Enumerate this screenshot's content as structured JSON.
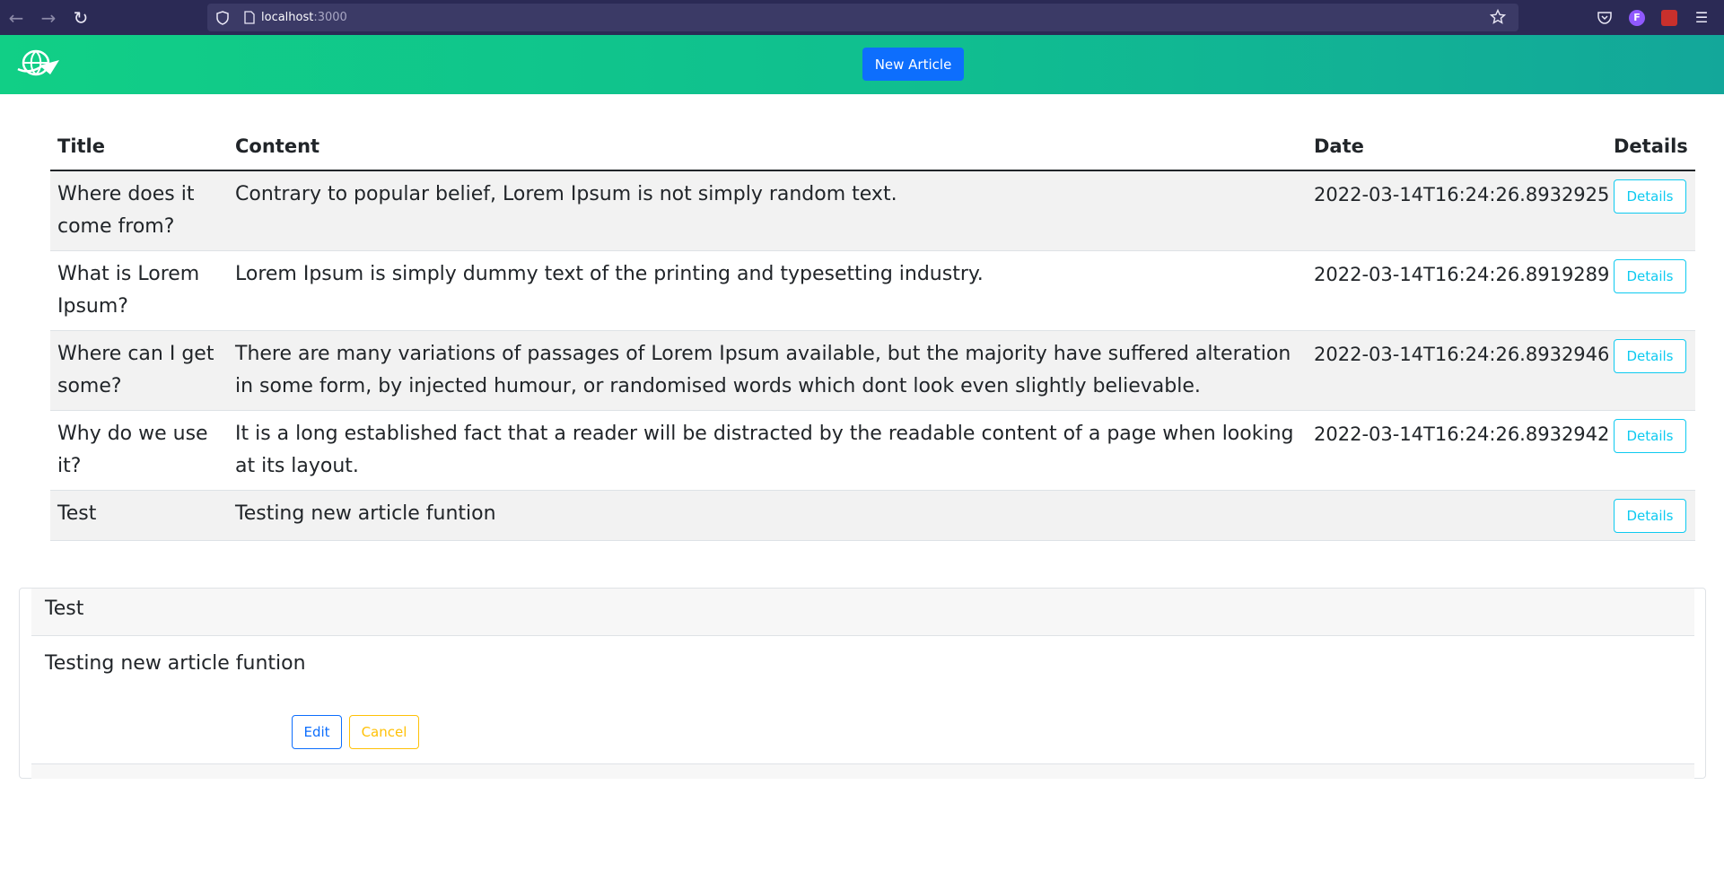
{
  "browser": {
    "url_host": "localhost",
    "url_port": ":3000",
    "profile_initial": "F"
  },
  "header": {
    "new_article_label": "New Article"
  },
  "table": {
    "columns": [
      "Title",
      "Content",
      "Date",
      "Details"
    ],
    "rows": [
      {
        "title": "Where does it come from?",
        "content": "Contrary to popular belief, Lorem Ipsum is not simply random text.",
        "date": "2022-03-14T16:24:26.8932925",
        "details_label": "Details"
      },
      {
        "title": "What is Lorem Ipsum?",
        "content": "Lorem Ipsum is simply dummy text of the printing and typesetting industry.",
        "date": "2022-03-14T16:24:26.8919289",
        "details_label": "Details"
      },
      {
        "title": "Where can I get some?",
        "content": "There are many variations of passages of Lorem Ipsum available, but the majority have suffered alteration in some form, by injected humour, or randomised words which dont look even slightly believable.",
        "date": "2022-03-14T16:24:26.8932946",
        "details_label": "Details"
      },
      {
        "title": "Why do we use it?",
        "content": "It is a long established fact that a reader will be distracted by the readable content of a page when looking at its layout.",
        "date": "2022-03-14T16:24:26.8932942",
        "details_label": "Details"
      },
      {
        "title": "Test",
        "content": "Testing new article funtion",
        "date": "",
        "details_label": "Details"
      }
    ]
  },
  "detail": {
    "title": "Test",
    "content": "Testing new article funtion",
    "edit_label": "Edit",
    "cancel_label": "Cancel"
  },
  "colors": {
    "primary": "#0d6efd",
    "info": "#0dcaf0",
    "warning": "#ffc107",
    "header_gradient_start": "#11cf86",
    "header_gradient_end": "#13a79a"
  }
}
